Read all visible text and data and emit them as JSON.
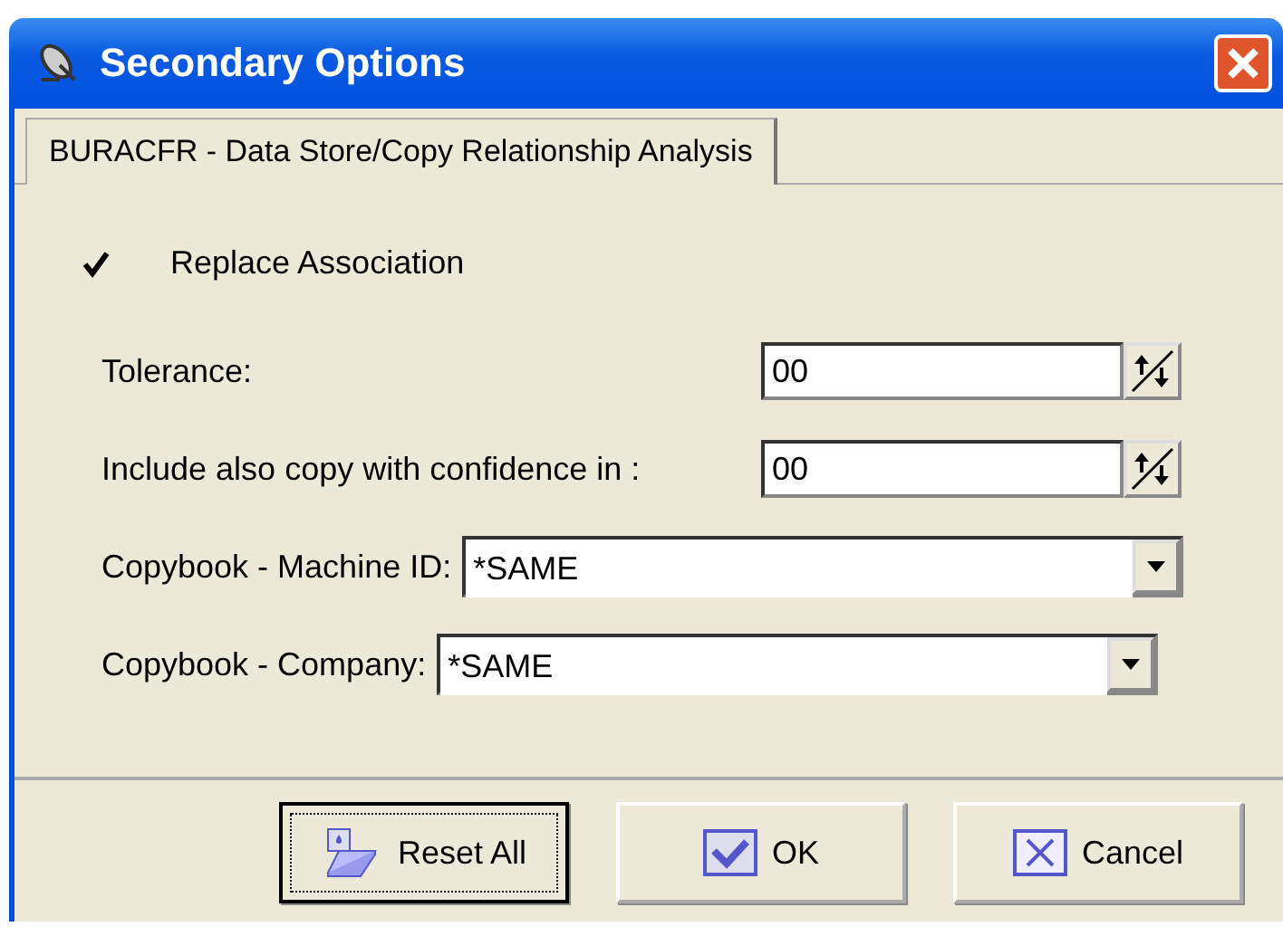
{
  "window": {
    "title": "Secondary Options"
  },
  "tabs": [
    {
      "label": "BURACFR - Data Store/Copy Relationship Analysis",
      "selected": true
    }
  ],
  "replace_association": {
    "label": "Replace Association",
    "checked": true
  },
  "fields": [
    {
      "kind": "spin",
      "label": "Tolerance:",
      "value": "00"
    },
    {
      "kind": "spin",
      "label": "Include also copy with confidence in :",
      "value": "00"
    },
    {
      "kind": "combo",
      "label": "Copybook - Machine ID:",
      "value": "*SAME"
    },
    {
      "kind": "combo",
      "label": "Copybook - Company:",
      "value": "*SAME"
    }
  ],
  "buttons": [
    {
      "kind": "reset",
      "label": "Reset All",
      "focused": true
    },
    {
      "kind": "ok",
      "label": "OK",
      "focused": false
    },
    {
      "kind": "cancel",
      "label": "Cancel",
      "focused": false
    }
  ]
}
